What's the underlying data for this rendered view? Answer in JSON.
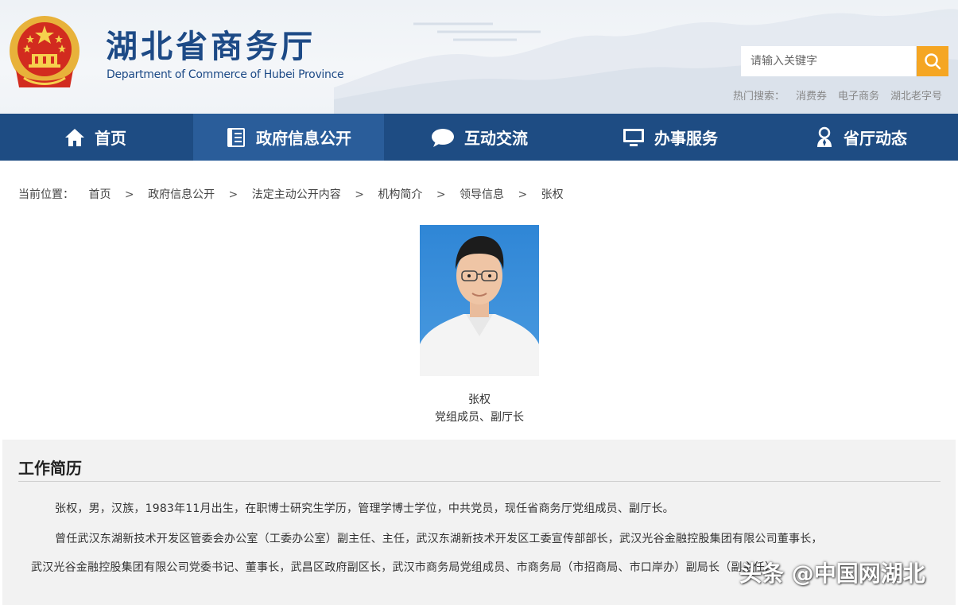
{
  "site": {
    "title": "湖北省商务厅",
    "subtitle": "Department of Commerce of Hubei Province"
  },
  "search": {
    "placeholder": "请输入关键字",
    "hot_label": "热门搜索：",
    "hot_terms": [
      "消费券",
      "电子商务",
      "湖北老字号"
    ]
  },
  "nav": [
    {
      "label": "首页",
      "icon": "home-icon"
    },
    {
      "label": "政府信息公开",
      "icon": "document-icon",
      "active": true
    },
    {
      "label": "互动交流",
      "icon": "chat-bubble-icon"
    },
    {
      "label": "办事服务",
      "icon": "monitor-icon"
    },
    {
      "label": "省厅动态",
      "icon": "person-badge-icon"
    }
  ],
  "breadcrumb": {
    "prefix": "当前位置：",
    "items": [
      "首页",
      "政府信息公开",
      "法定主动公开内容",
      "机构简介",
      "领导信息",
      "张权"
    ]
  },
  "person": {
    "name": "张权",
    "position": "党组成员、副厅长"
  },
  "resume": {
    "heading": "工作简历",
    "paragraphs": [
      "张权，男，汉族，1983年11月出生，在职博士研究生学历，管理学博士学位，中共党员，现任省商务厅党组成员、副厅长。",
      "曾任武汉东湖新技术开发区管委会办公室（工委办公室）副主任、主任，武汉东湖新技术开发区工委宣传部部长，武汉光谷金融控股集团有限公司董事长，",
      "武汉光谷金融控股集团有限公司党委书记、董事长，武昌区政府副区长，武汉市商务局党组成员、市商务局（市招商局、市口岸办）副局长（副主任）"
    ]
  },
  "watermark": "头条 @中国网湖北",
  "colors": {
    "nav_bg": "#1e4c83",
    "nav_active": "#2a5d9a",
    "title_blue": "#1d4a86",
    "search_button": "#f5a623"
  }
}
